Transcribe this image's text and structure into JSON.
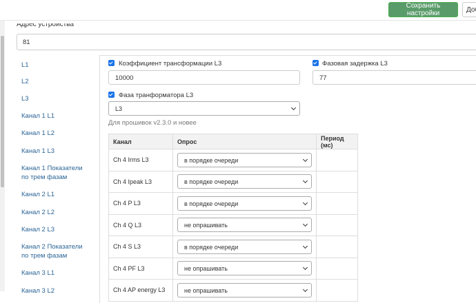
{
  "toolbar": {
    "save_label": "Сохранить настройки",
    "add_label": "Добавить"
  },
  "device": {
    "label": "Адрес устройства",
    "value": "81"
  },
  "sidebar": {
    "items": [
      {
        "label": "L1"
      },
      {
        "label": "L2"
      },
      {
        "label": "L3"
      },
      {
        "label": "Канал 1 L1"
      },
      {
        "label": "Канал 1 L2"
      },
      {
        "label": "Канал 1 L3"
      },
      {
        "label": "Канал 1 Показатели по трем фазам"
      },
      {
        "label": "Канал 2 L1"
      },
      {
        "label": "Канал 2 L2"
      },
      {
        "label": "Канал 2 L3"
      },
      {
        "label": "Канал 2 Показатели по трем фазам"
      },
      {
        "label": "Канал 3 L1"
      },
      {
        "label": "Канал 3 L2"
      }
    ]
  },
  "form": {
    "ct_ratio": {
      "label": "Коэффициент трансформации L3",
      "value": "10000"
    },
    "phase_delay": {
      "label": "Фазовая задержка L3",
      "value": "77"
    },
    "transformer_phase": {
      "label": "Фаза транформатора L3",
      "value": "L3"
    },
    "firmware_hint": "Для прошивок v2.3.0 и новее"
  },
  "poll_table": {
    "headers": {
      "channel": "Канал",
      "poll": "Опрос",
      "period": "Период (мс)"
    },
    "rows": [
      {
        "channel": "Ch 4 Irms L3",
        "poll": "в порядке очереди"
      },
      {
        "channel": "Ch 4 Ipeak L3",
        "poll": "в порядке очереди"
      },
      {
        "channel": "Ch 4 P L3",
        "poll": "в порядке очереди"
      },
      {
        "channel": "Ch 4 Q L3",
        "poll": "не опрашивать"
      },
      {
        "channel": "Ch 4 S L3",
        "poll": "в порядке очереди"
      },
      {
        "channel": "Ch 4 PF L3",
        "poll": "не опрашивать"
      },
      {
        "channel": "Ch 4 AP energy L3",
        "poll": "не опрашивать"
      }
    ]
  },
  "colors": {
    "save_button": "#5a9b6a",
    "link": "#2a6496",
    "checkbox": "#1a73e8"
  }
}
